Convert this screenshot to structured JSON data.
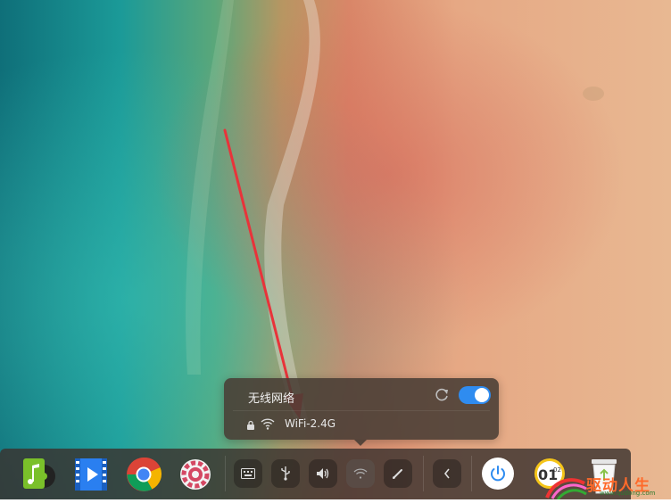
{
  "wifi_popup": {
    "title": "无线网络",
    "enabled": true,
    "network": {
      "name": "WiFi-2.4G",
      "secured": true
    }
  },
  "dock": {
    "apps": [
      {
        "name": "music-app",
        "icon": "music-note-icon"
      },
      {
        "name": "video-app",
        "icon": "film-play-icon"
      },
      {
        "name": "browser-app",
        "icon": "chrome-icon"
      },
      {
        "name": "settings-app",
        "icon": "gear-icon"
      }
    ],
    "tray": [
      {
        "name": "keyboard",
        "icon": "keyboard-icon"
      },
      {
        "name": "usb",
        "icon": "usb-icon"
      },
      {
        "name": "volume",
        "icon": "speaker-icon"
      },
      {
        "name": "network",
        "icon": "wifi-icon"
      },
      {
        "name": "pen",
        "icon": "pen-icon"
      },
      {
        "name": "collapse",
        "icon": "chevron-left-icon"
      }
    ],
    "clock_digits": "01",
    "clock_small": "02"
  },
  "watermark": {
    "text": "驱动人生",
    "url": "www.qudong.com"
  },
  "colors": {
    "toggle_on": "#2f8cf0",
    "annotation_arrow": "#e8333a",
    "music_green": "#7ac02a",
    "video_blue": "#2a7ff0"
  }
}
